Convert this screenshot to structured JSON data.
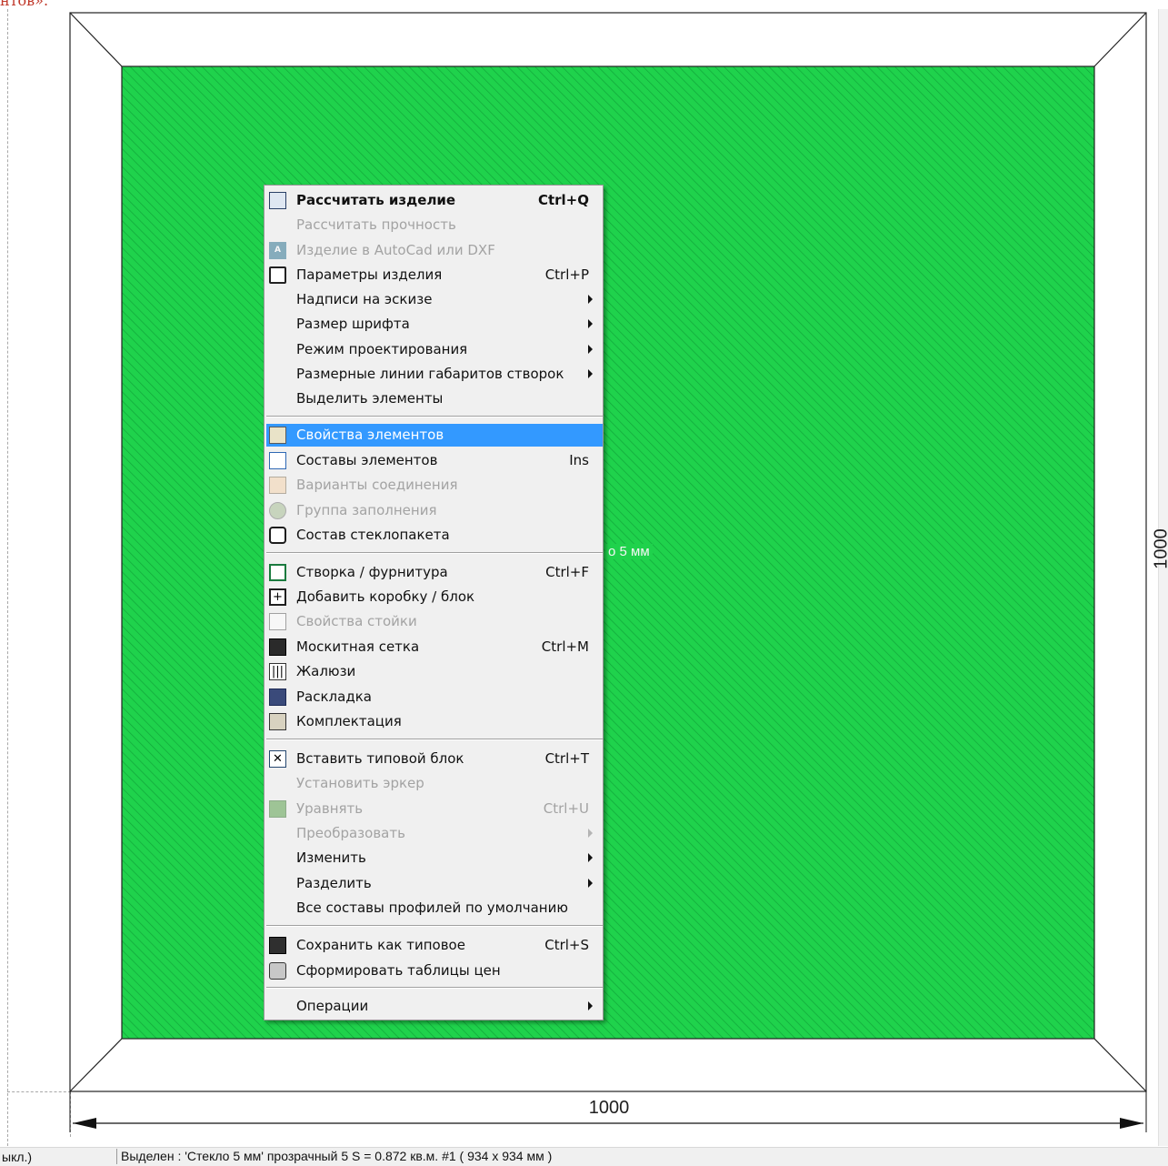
{
  "page_caption": "нтов».",
  "drawing": {
    "glass_label": "о 5 мм",
    "width_label": "1000",
    "height_label": "1000"
  },
  "colors": {
    "glass": "#1fd24c",
    "hatch": "#11a63a",
    "menu_highlight": "#3399ff",
    "menu_background": "#f0f0f0",
    "disabled_text": "#a3a3a3"
  },
  "menu": {
    "items": [
      {
        "label": "Рассчитать изделие",
        "shortcut": "Ctrl+Q",
        "icon": "calculator-icon",
        "bold": true
      },
      {
        "label": "Рассчитать прочность",
        "disabled": true
      },
      {
        "label": "Изделие в AutoCad или DXF",
        "icon": "autocad-icon",
        "disabled": true
      },
      {
        "label": "Параметры изделия",
        "shortcut": "Ctrl+P",
        "icon": "document-icon"
      },
      {
        "label": "Надписи на эскизе",
        "submenu": true
      },
      {
        "label": "Размер шрифта",
        "submenu": true
      },
      {
        "label": "Режим проектирования",
        "submenu": true
      },
      {
        "label": "Размерные линии габаритов створок",
        "submenu": true
      },
      {
        "label": "Выделить элементы"
      },
      {
        "label": "Свойства элементов",
        "icon": "properties-icon",
        "highlighted": true
      },
      {
        "label": "Составы элементов",
        "shortcut": "Ins",
        "icon": "composition-icon"
      },
      {
        "label": "Варианты соединения",
        "icon": "joint-icon",
        "disabled": true
      },
      {
        "label": "Группа заполнения",
        "icon": "fill-group-icon",
        "disabled": true
      },
      {
        "label": "Состав стеклопакета",
        "icon": "glass-unit-icon"
      },
      {
        "label": "Створка / фурнитура",
        "shortcut": "Ctrl+F",
        "icon": "sash-icon"
      },
      {
        "label": "Добавить коробку / блок",
        "icon": "add-box-icon"
      },
      {
        "label": "Свойства стойки",
        "icon": "post-icon",
        "disabled": true
      },
      {
        "label": "Москитная сетка",
        "shortcut": "Ctrl+M",
        "icon": "mosquito-net-icon"
      },
      {
        "label": "Жалюзи",
        "icon": "blinds-icon"
      },
      {
        "label": "Раскладка",
        "icon": "muntin-icon"
      },
      {
        "label": "Комплектация",
        "icon": "kit-icon"
      },
      {
        "label": "Вставить типовой блок",
        "shortcut": "Ctrl+T",
        "icon": "insert-block-icon"
      },
      {
        "label": "Установить эркер",
        "disabled": true
      },
      {
        "label": "Уравнять",
        "shortcut": "Ctrl+U",
        "icon": "align-icon",
        "disabled": true
      },
      {
        "label": "Преобразовать",
        "submenu": true,
        "disabled": true
      },
      {
        "label": "Изменить",
        "submenu": true
      },
      {
        "label": "Разделить",
        "submenu": true
      },
      {
        "label": "Все составы профилей по умолчанию"
      },
      {
        "label": "Сохранить как типовое",
        "shortcut": "Ctrl+S",
        "icon": "save-template-icon"
      },
      {
        "label": "Сформировать таблицы цен",
        "icon": "price-table-icon"
      },
      {
        "label": "Операции",
        "submenu": true
      }
    ]
  },
  "status": {
    "left": "ыкл.)",
    "main": "Выделен : 'Стекло 5 мм' прозрачный 5    S = 0.872 кв.м.  #1 ( 934 x 934 мм )"
  }
}
